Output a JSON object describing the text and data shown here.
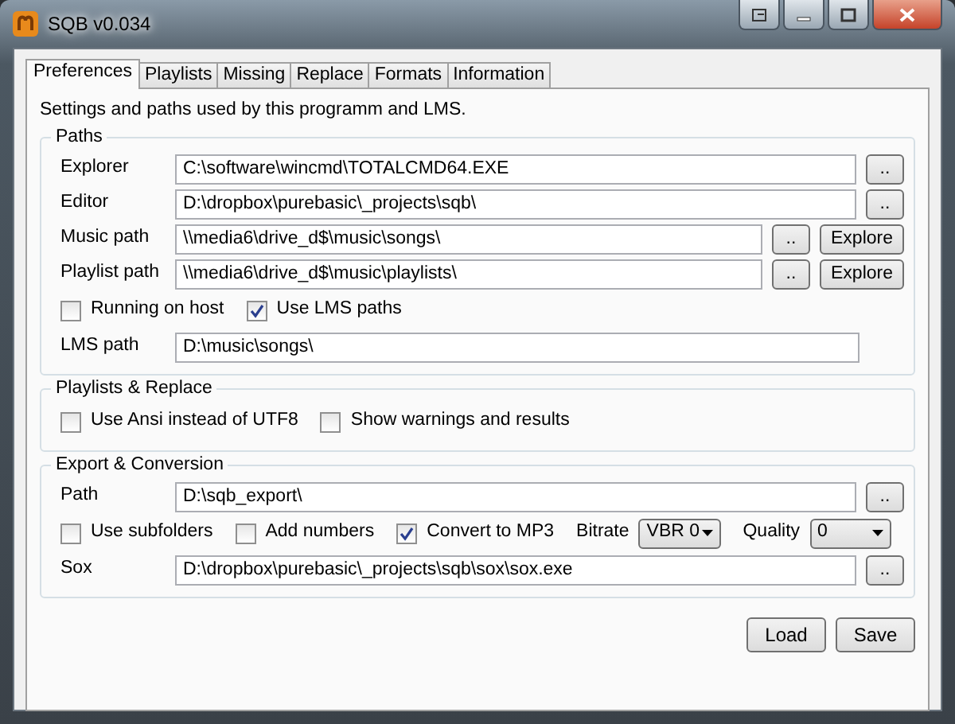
{
  "window": {
    "title": "SQB v0.034"
  },
  "tabs": [
    {
      "label": "Preferences",
      "selected": true
    },
    {
      "label": "Playlists",
      "selected": false
    },
    {
      "label": "Missing",
      "selected": false
    },
    {
      "label": "Replace",
      "selected": false
    },
    {
      "label": "Formats",
      "selected": false
    },
    {
      "label": "Information",
      "selected": false
    }
  ],
  "description": "Settings and paths used by this programm and LMS.",
  "groups": [
    {
      "title": "Paths",
      "rows": [
        {
          "kind": "path",
          "label": "Explorer",
          "value": "C:\\software\\wincmd\\TOTALCMD64.EXE",
          "buttons": [
            ".."
          ]
        },
        {
          "kind": "path",
          "label": "Editor",
          "value": "D:\\dropbox\\purebasic\\_projects\\sqb\\",
          "buttons": [
            ".."
          ]
        },
        {
          "kind": "path",
          "label": "Music path",
          "value": "\\\\media6\\drive_d$\\music\\songs\\",
          "buttons": [
            "..",
            "Explore"
          ]
        },
        {
          "kind": "path",
          "label": "Playlist path",
          "value": "\\\\media6\\drive_d$\\music\\playlists\\",
          "buttons": [
            "..",
            "Explore"
          ]
        },
        {
          "kind": "options",
          "items": [
            {
              "kind": "checkbox",
              "label": "Running on host",
              "checked": false
            },
            {
              "kind": "checkbox",
              "label": "Use LMS paths",
              "checked": true
            }
          ]
        },
        {
          "kind": "path",
          "label": "LMS path",
          "value": "D:\\music\\songs\\",
          "buttons": []
        }
      ]
    },
    {
      "title": "Playlists & Replace",
      "rows": [
        {
          "kind": "options",
          "items": [
            {
              "kind": "checkbox",
              "label": "Use Ansi instead of UTF8",
              "checked": false
            },
            {
              "kind": "checkbox",
              "label": "Show warnings and results",
              "checked": false
            }
          ]
        }
      ]
    },
    {
      "title": "Export & Conversion",
      "rows": [
        {
          "kind": "path",
          "label": "Path",
          "value": "D:\\sqb_export\\",
          "buttons": [
            ".."
          ]
        },
        {
          "kind": "options",
          "items": [
            {
              "kind": "checkbox",
              "label": "Use subfolders",
              "checked": false
            },
            {
              "kind": "checkbox",
              "label": "Add numbers",
              "checked": false
            },
            {
              "kind": "checkbox",
              "label": "Convert to MP3",
              "checked": true
            },
            {
              "kind": "select",
              "label": "Bitrate",
              "value": "VBR 0"
            },
            {
              "kind": "select",
              "label": "Quality",
              "value": "0"
            }
          ]
        },
        {
          "kind": "path",
          "label": "Sox",
          "value": "D:\\dropbox\\purebasic\\_projects\\sqb\\sox\\sox.exe",
          "buttons": [
            ".."
          ]
        }
      ]
    }
  ],
  "buttons": [
    "Load",
    "Save"
  ]
}
